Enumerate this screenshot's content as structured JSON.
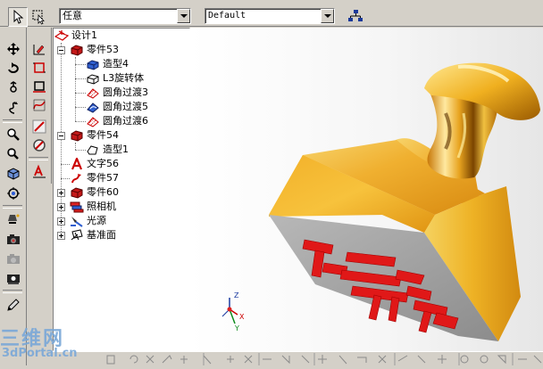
{
  "toolbar": {
    "filter_combo_value": "任意",
    "style_combo_value": "Default"
  },
  "tree": {
    "items": [
      {
        "label": "设计1"
      },
      {
        "label": "零件53"
      },
      {
        "label": "造型4"
      },
      {
        "label": "L3旋转体"
      },
      {
        "label": "圆角过渡3"
      },
      {
        "label": "圆角过渡5"
      },
      {
        "label": "圆角过渡6"
      },
      {
        "label": "零件54"
      },
      {
        "label": "造型1"
      },
      {
        "label": "文字56"
      },
      {
        "label": "零件57"
      },
      {
        "label": "零件60"
      },
      {
        "label": "照相机"
      },
      {
        "label": "光源"
      },
      {
        "label": "基准面"
      }
    ]
  },
  "viewport": {
    "axis_labels": {
      "z": "Z",
      "x": "X",
      "y": "Y"
    },
    "colors": {
      "stamp_gold": "#f0a818",
      "stamp_face": "#a8a8a8",
      "text_red": "#e01818"
    }
  },
  "watermark": {
    "logo_text": "三维网",
    "url_text": "3dPortal.cn"
  }
}
